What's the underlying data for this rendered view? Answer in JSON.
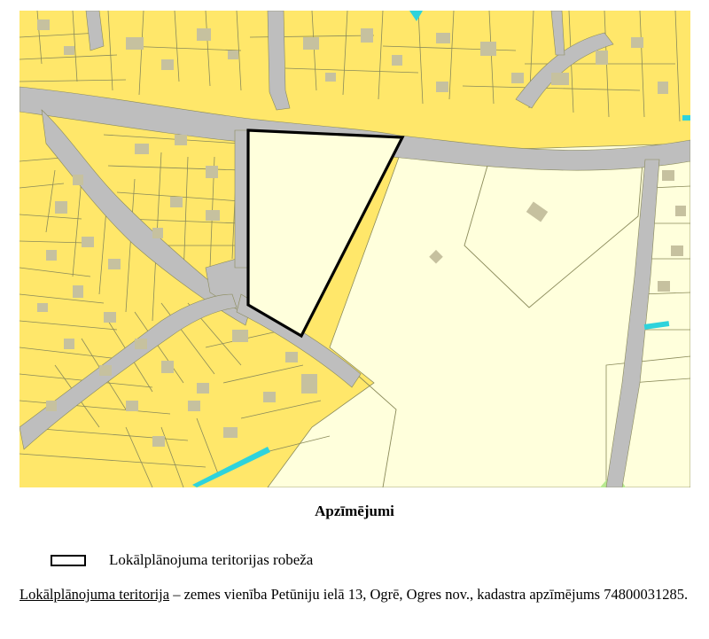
{
  "legend": {
    "title": "Apzīmējumi",
    "items": [
      {
        "label": "Lokālplānojuma teritorijas robeža",
        "symbol": "boundary-outline"
      }
    ]
  },
  "description": {
    "term": "Lokālplānojuma teritorija",
    "text": " – zemes vienība Petūniju ielā 13, Ogrē, Ogres nov., kadastra apzīmējums 74800031285."
  },
  "map_colors": {
    "background": "#FFE76A",
    "parcel_outline": "#8A8A5A",
    "road": "#BEBEBE",
    "building": "#C6C19F",
    "public_territory": "#FFFFDC",
    "water": "#2ED3DC",
    "green": "#B7E990",
    "boundary": "#000000"
  }
}
